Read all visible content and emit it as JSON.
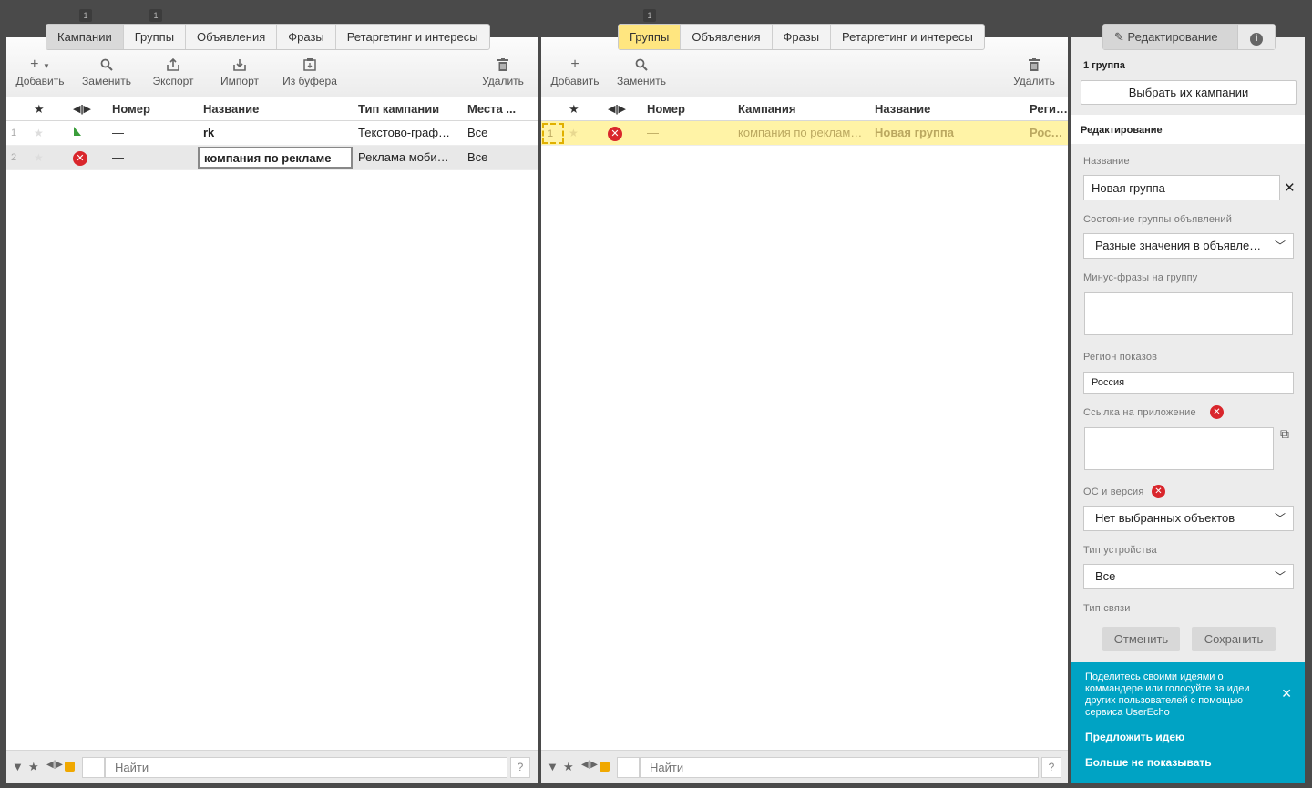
{
  "left": {
    "tab_counts": [
      "1",
      "1"
    ],
    "tabs": [
      "Кампании",
      "Группы",
      "Объявления",
      "Фразы",
      "Ретаргетинг и интересы"
    ],
    "toolbar": {
      "add": "Добавить",
      "replace": "Заменить",
      "export": "Экспорт",
      "import": "Импорт",
      "from_buffer": "Из буфера",
      "delete": "Удалить"
    },
    "columns": {
      "number": "Номер",
      "name": "Название",
      "type": "Тип кампании",
      "places": "Места ..."
    },
    "rows": [
      {
        "idx": "1",
        "number": "—",
        "name": "rk",
        "type": "Текстово-граф…",
        "places": "Все",
        "status": "green-flag"
      },
      {
        "idx": "2",
        "number": "—",
        "name": "компания по рекламе",
        "type": "Реклама моби…",
        "places": "Все",
        "status": "error"
      }
    ],
    "search_placeholder": "Найти",
    "help": "?"
  },
  "middle": {
    "tab_count": "1",
    "tabs": [
      "Группы",
      "Объявления",
      "Фразы",
      "Ретаргетинг и интересы"
    ],
    "toolbar": {
      "add": "Добавить",
      "replace": "Заменить",
      "delete": "Удалить"
    },
    "columns": {
      "number": "Номер",
      "campaign": "Кампания",
      "name": "Название",
      "region": "Регион"
    },
    "rows": [
      {
        "idx": "1",
        "number": "—",
        "campaign": "компания по реклам…",
        "name": "Новая группа",
        "region": "Россия"
      }
    ],
    "search_placeholder": "Найти",
    "help": "?"
  },
  "right": {
    "tabs": {
      "edit": "Редактирование",
      "info": "i"
    },
    "count": "1 группа",
    "choose_campaigns": "Выбрать их кампании",
    "section_title": "Редактирование",
    "name_label": "Название",
    "name_value": "Новая группа",
    "state_label": "Состояние группы объявлений",
    "state_value": "Разные значения в объявле…",
    "minus_label": "Минус-фразы на группу",
    "region_label": "Регион показов",
    "region_value": "Россия",
    "app_link_label": "Ссылка на приложение",
    "os_label": "ОС и версия",
    "os_value": "Нет выбранных объектов",
    "device_label": "Тип устройства",
    "device_value": "Все",
    "connection_label": "Тип связи",
    "cancel": "Отменить",
    "save": "Сохранить"
  },
  "banner": {
    "text": "Поделитесь своими идеями о коммандере или голосуйте за идеи других пользователей с помощью сервиса UserEcho",
    "suggest": "Предложить идею",
    "dont_show": "Больше не показывать"
  },
  "colors": {
    "selected_row": "#fff3a6",
    "active_tab": "#ffe680",
    "banner": "#00a3c4",
    "error": "#d9262c"
  }
}
